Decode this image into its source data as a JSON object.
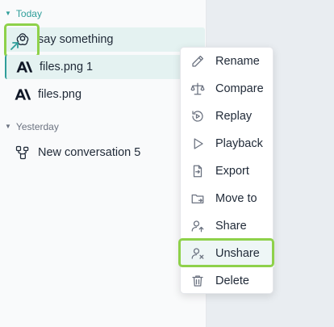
{
  "sidebar": {
    "groups": [
      {
        "label": "Today",
        "color": "#2f9e9a"
      },
      {
        "label": "Yesterday",
        "color": "#6b7280"
      }
    ],
    "conversations": [
      {
        "title": "say something",
        "icon": "openai-icon",
        "state": "hovered"
      },
      {
        "title": "files.png 1",
        "icon": "anthropic-icon",
        "state": "selected"
      },
      {
        "title": "files.png",
        "icon": "anthropic-icon",
        "state": "normal"
      },
      {
        "title": "New conversation 5",
        "icon": "multi-model-icon",
        "state": "normal"
      }
    ]
  },
  "context_menu": {
    "items": [
      {
        "label": "Rename",
        "icon": "pencil-icon"
      },
      {
        "label": "Compare",
        "icon": "scale-icon"
      },
      {
        "label": "Replay",
        "icon": "replay-icon"
      },
      {
        "label": "Playback",
        "icon": "play-icon"
      },
      {
        "label": "Export",
        "icon": "export-icon"
      },
      {
        "label": "Move to",
        "icon": "folder-icon"
      },
      {
        "label": "Share",
        "icon": "share-user-icon"
      },
      {
        "label": "Unshare",
        "icon": "unshare-user-icon",
        "state": "hovered"
      },
      {
        "label": "Delete",
        "icon": "trash-icon"
      }
    ]
  },
  "colors": {
    "accent": "#2f9e9a",
    "highlight": "#8ed14a",
    "row_bg": "#e4f2f1"
  }
}
